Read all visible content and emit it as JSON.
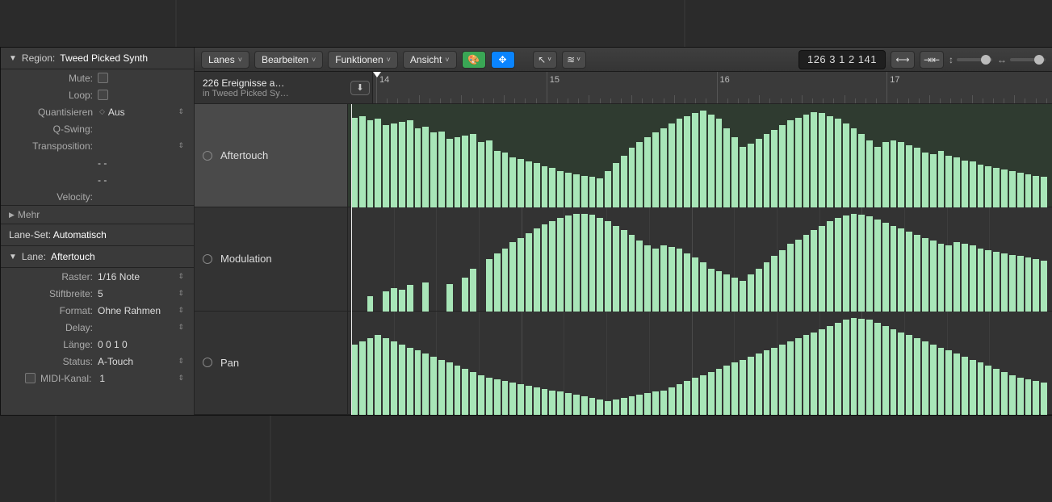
{
  "inspector": {
    "region_label": "Region:",
    "region_value": "Tweed Picked Synth",
    "params": {
      "mute": "Mute:",
      "loop": "Loop:",
      "quantize_label": "Quantisieren",
      "quantize_value": "Aus",
      "qswing": "Q-Swing:",
      "transposition": "Transposition:",
      "dash1": "- -",
      "dash2": "- -",
      "velocity": "Velocity:"
    },
    "more": "Mehr",
    "lane_set_label": "Lane-Set:",
    "lane_set_value": "Automatisch",
    "lane_label": "Lane:",
    "lane_value": "Aftertouch",
    "lane_params": {
      "raster_label": "Raster:",
      "raster_value": "1/16 Note",
      "stiftbreite_label": "Stiftbreite:",
      "stiftbreite_value": "5",
      "format_label": "Format:",
      "format_value": "Ohne Rahmen",
      "delay_label": "Delay:",
      "laenge_label": "Länge:",
      "laenge_value": "0  0  1     0",
      "status_label": "Status:",
      "status_value": "A-Touch",
      "midi_label": "MIDI-Kanal:",
      "midi_value": "1"
    }
  },
  "toolbar": {
    "lanes": "Lanes",
    "bearbeiten": "Bearbeiten",
    "funktionen": "Funktionen",
    "ansicht": "Ansicht",
    "lcd": "126  3 1 2 141",
    "icon_midi_out": "midi-out",
    "icon_catch": "catch",
    "icon_pointer": "pointer",
    "icon_pencil": "pencil"
  },
  "info": {
    "line1": "226 Ereignisse a…",
    "line2": "in Tweed Picked Sy…"
  },
  "ruler": {
    "labels": [
      "14",
      "15",
      "16",
      "17"
    ]
  },
  "lanes": [
    {
      "name": "Aftertouch"
    },
    {
      "name": "Modulation"
    },
    {
      "name": "Pan"
    }
  ],
  "chart_data": [
    {
      "type": "bar",
      "name": "Aftertouch",
      "ylim": [
        0,
        127
      ],
      "values": [
        118,
        120,
        114,
        116,
        108,
        110,
        112,
        114,
        104,
        106,
        98,
        100,
        90,
        92,
        94,
        96,
        86,
        88,
        74,
        72,
        66,
        64,
        60,
        58,
        54,
        52,
        48,
        46,
        44,
        42,
        40,
        38,
        48,
        58,
        68,
        78,
        86,
        92,
        98,
        104,
        110,
        116,
        120,
        124,
        127,
        122,
        116,
        104,
        92,
        80,
        84,
        90,
        96,
        102,
        108,
        114,
        118,
        122,
        125,
        124,
        120,
        116,
        110,
        104,
        96,
        88,
        80,
        86,
        88,
        86,
        82,
        78,
        72,
        70,
        74,
        68,
        66,
        62,
        60,
        56,
        54,
        52,
        50,
        48,
        46,
        44,
        42,
        40
      ]
    },
    {
      "type": "bar",
      "name": "Modulation",
      "ylim": [
        0,
        127
      ],
      "values": [
        0,
        0,
        20,
        0,
        26,
        30,
        28,
        34,
        0,
        38,
        0,
        0,
        36,
        0,
        44,
        56,
        0,
        68,
        76,
        82,
        90,
        96,
        102,
        108,
        114,
        118,
        122,
        125,
        127,
        127,
        126,
        122,
        118,
        112,
        106,
        100,
        92,
        86,
        82,
        86,
        84,
        82,
        76,
        70,
        64,
        56,
        52,
        48,
        44,
        40,
        48,
        56,
        64,
        72,
        80,
        88,
        94,
        100,
        106,
        112,
        118,
        122,
        125,
        127,
        126,
        124,
        120,
        116,
        112,
        108,
        104,
        100,
        96,
        92,
        88,
        86,
        90,
        88,
        86,
        82,
        80,
        78,
        76,
        74,
        72,
        70,
        68,
        66
      ]
    },
    {
      "type": "bar",
      "name": "Pan",
      "ylim": [
        0,
        127
      ],
      "values": [
        92,
        96,
        100,
        104,
        100,
        96,
        92,
        88,
        84,
        80,
        76,
        72,
        68,
        64,
        60,
        56,
        52,
        48,
        46,
        44,
        42,
        40,
        38,
        36,
        34,
        32,
        30,
        28,
        26,
        24,
        22,
        20,
        18,
        20,
        22,
        24,
        26,
        28,
        30,
        32,
        36,
        40,
        44,
        48,
        52,
        56,
        60,
        64,
        68,
        72,
        76,
        80,
        84,
        88,
        92,
        96,
        100,
        104,
        108,
        112,
        116,
        120,
        124,
        127,
        126,
        124,
        120,
        116,
        112,
        108,
        104,
        100,
        96,
        92,
        88,
        84,
        80,
        76,
        72,
        68,
        64,
        60,
        56,
        52,
        48,
        46,
        44,
        42
      ]
    }
  ]
}
